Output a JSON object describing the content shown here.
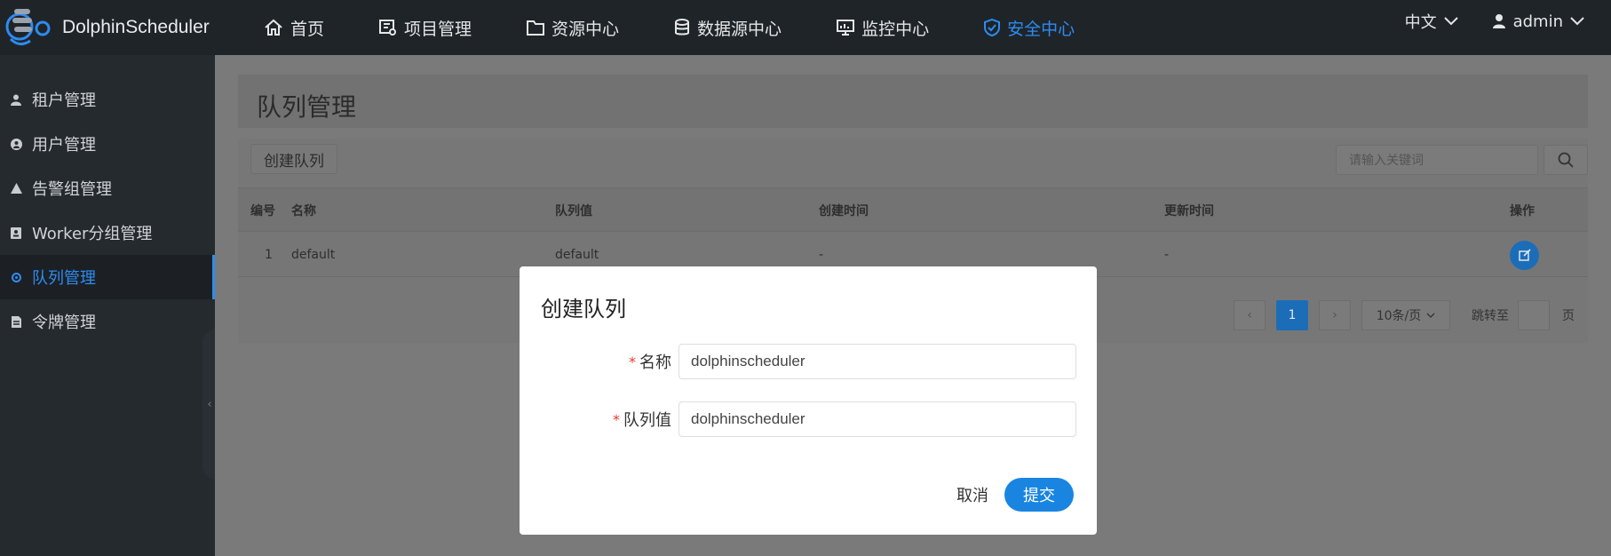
{
  "app": {
    "brand": "DolphinScheduler"
  },
  "nav": {
    "items": [
      {
        "label": "首页",
        "icon": "home-icon"
      },
      {
        "label": "项目管理",
        "icon": "project-icon"
      },
      {
        "label": "资源中心",
        "icon": "folder-icon"
      },
      {
        "label": "数据源中心",
        "icon": "database-icon"
      },
      {
        "label": "监控中心",
        "icon": "monitor-icon"
      },
      {
        "label": "安全中心",
        "icon": "shield-icon",
        "active": true
      }
    ],
    "language": "中文",
    "user": "admin"
  },
  "sidebar": {
    "items": [
      {
        "label": "租户管理",
        "icon": "user-icon"
      },
      {
        "label": "用户管理",
        "icon": "user-circle-icon"
      },
      {
        "label": "告警组管理",
        "icon": "warning-icon"
      },
      {
        "label": "Worker分组管理",
        "icon": "id-card-icon"
      },
      {
        "label": "队列管理",
        "icon": "queue-icon",
        "active": true
      },
      {
        "label": "令牌管理",
        "icon": "document-icon"
      }
    ]
  },
  "page": {
    "title": "队列管理",
    "create_button": "创建队列",
    "search_placeholder": "请输入关键词"
  },
  "table": {
    "columns": [
      "编号",
      "名称",
      "队列值",
      "创建时间",
      "更新时间",
      "操作"
    ],
    "rows": [
      {
        "id": "1",
        "name": "default",
        "queue": "default",
        "created": "-",
        "updated": "-"
      }
    ]
  },
  "pagination": {
    "current_page": "1",
    "page_size": "10条/页",
    "goto_label": "跳转至",
    "page_unit": "页"
  },
  "modal": {
    "title": "创建队列",
    "required_mark": "*",
    "name_label": "名称",
    "name_value": "dolphinscheduler",
    "queue_label": "队列值",
    "queue_value": "dolphinscheduler",
    "cancel": "取消",
    "submit": "提交"
  },
  "colors": {
    "accent": "#2d8cf0",
    "primary_button": "#1a85e1",
    "topbar": "#1f2429",
    "sidebar": "#252a2f",
    "required": "#e53935"
  }
}
